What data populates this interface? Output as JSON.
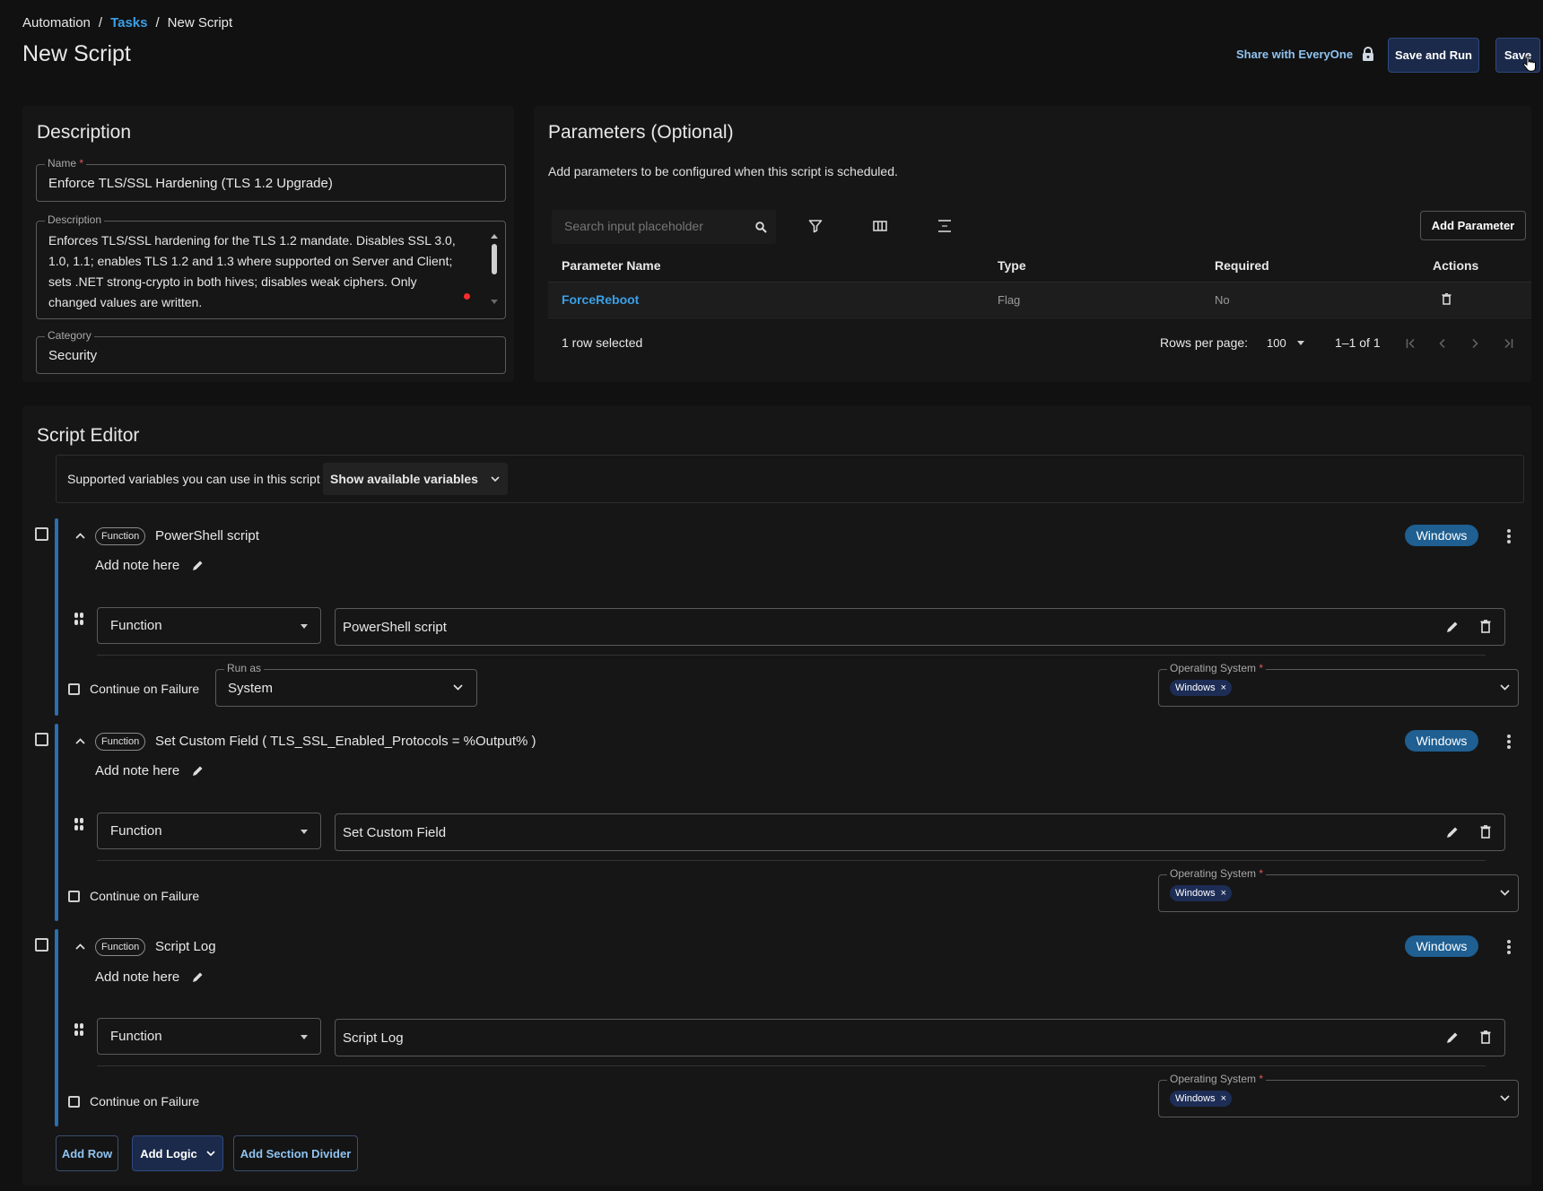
{
  "breadcrumb": {
    "root": "Automation",
    "sep1": "/",
    "tasks": "Tasks",
    "sep2": "/",
    "current": "New Script"
  },
  "page_title": "New Script",
  "header_actions": {
    "share": "Share with EveryOne",
    "save_run": "Save and Run",
    "save": "Save"
  },
  "description_card": {
    "title": "Description",
    "name_label": "Name",
    "required_mark": "*",
    "name_value": "Enforce TLS/SSL Hardening (TLS 1.2 Upgrade)",
    "desc_label": "Description",
    "desc_lines": [
      "Enforces TLS/SSL hardening for the TLS 1.2 mandate. Disables SSL 3.0,",
      "1.0, 1.1; enables TLS 1.2 and 1.3 where supported on Server and Client;",
      "sets .NET strong-crypto in both hives; disables weak ciphers. Only",
      "changed values are written."
    ],
    "category_label": "Category",
    "category_value": "Security"
  },
  "params_card": {
    "title": "Parameters (Optional)",
    "subtitle": "Add parameters to be configured when this script is scheduled.",
    "search_placeholder": "Search input placeholder",
    "add_parameter": "Add Parameter",
    "columns": [
      "Parameter Name",
      "Type",
      "Required",
      "Actions"
    ],
    "rows": [
      {
        "name": "ForceReboot",
        "type": "Flag",
        "required": "No"
      }
    ],
    "selected_text": "1 row selected",
    "rows_per_page_label": "Rows per page:",
    "rows_per_page": "100",
    "range": "1–1 of 1"
  },
  "editor": {
    "title": "Script Editor",
    "vars_text": "Supported variables you can use in this script",
    "vars_button": "Show available variables",
    "steps": [
      {
        "chip": "Function",
        "title": "PowerShell script",
        "badge": "Windows",
        "note": "Add note here",
        "type_value": "Function",
        "function_value": "PowerShell script",
        "continue_label": "Continue on Failure",
        "run_as_label": "Run as",
        "run_as_value": "System",
        "os_label": "Operating System",
        "os_chip": "Windows"
      },
      {
        "chip": "Function",
        "title": "Set Custom Field ( TLS_SSL_Enabled_Protocols = %Output% )",
        "badge": "Windows",
        "note": "Add note here",
        "type_value": "Function",
        "function_value": "Set Custom Field",
        "continue_label": "Continue on Failure",
        "os_label": "Operating System",
        "os_chip": "Windows"
      },
      {
        "chip": "Function",
        "title": "Script Log",
        "badge": "Windows",
        "note": "Add note here",
        "type_value": "Function",
        "function_value": "Script Log",
        "continue_label": "Continue on Failure",
        "os_label": "Operating System",
        "os_chip": "Windows"
      }
    ],
    "add_row": "Add Row",
    "add_logic": "Add Logic",
    "add_section_divider": "Add Section Divider"
  },
  "colors": {
    "background": "#111111",
    "card": "#161616",
    "accent": "#3aa0e8",
    "badge": "#1f5f91",
    "button": "#1b2a4a"
  }
}
